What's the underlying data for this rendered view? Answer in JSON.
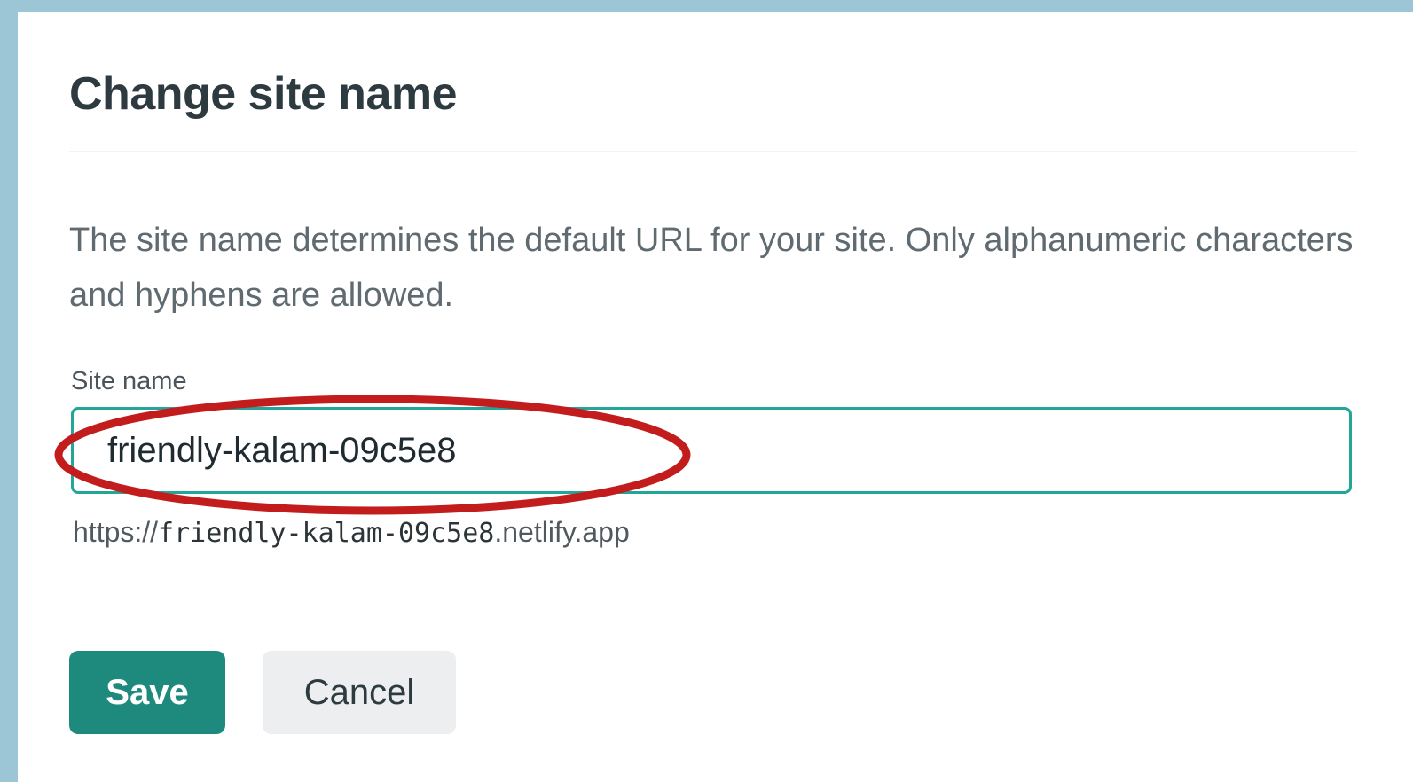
{
  "dialog": {
    "title": "Change site name",
    "description": "The site name determines the default URL for your site. Only alphanumeric characters and hyphens are allowed.",
    "field": {
      "label": "Site name",
      "value": "friendly-kalam-09c5e8"
    },
    "url_preview": {
      "prefix": "https://",
      "site": "friendly-kalam-09c5e8",
      "suffix": ".netlify.app"
    },
    "buttons": {
      "save": "Save",
      "cancel": "Cancel"
    }
  },
  "colors": {
    "background": "#9cc6d6",
    "panel": "#ffffff",
    "input_border": "#23a699",
    "save_button": "#1e8a7d",
    "cancel_button": "#eceeef",
    "annotation_ellipse": "#c31c1c"
  }
}
